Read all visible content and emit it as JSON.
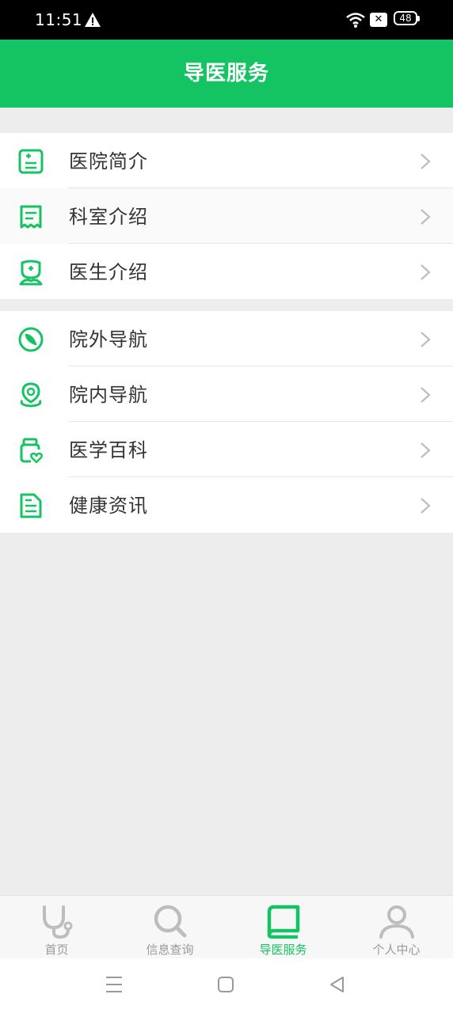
{
  "status": {
    "time": "11:51",
    "battery": "48",
    "x_badge": "✕"
  },
  "header": {
    "title": "导医服务"
  },
  "groups": [
    {
      "items": [
        {
          "label": "医院简介",
          "icon": "clipboard-plus-icon"
        },
        {
          "label": "科室介绍",
          "icon": "receipt-icon"
        },
        {
          "label": "医生介绍",
          "icon": "doctor-icon"
        }
      ]
    },
    {
      "items": [
        {
          "label": "院外导航",
          "icon": "compass-icon"
        },
        {
          "label": "院内导航",
          "icon": "location-pin-icon"
        },
        {
          "label": "医学百科",
          "icon": "medicine-bottle-icon"
        },
        {
          "label": "健康资讯",
          "icon": "document-icon"
        }
      ]
    }
  ],
  "tabbar": {
    "active": 2,
    "tabs": [
      {
        "label": "首页",
        "icon": "stethoscope-icon"
      },
      {
        "label": "信息查询",
        "icon": "search-icon"
      },
      {
        "label": "导医服务",
        "icon": "book-icon"
      },
      {
        "label": "个人中心",
        "icon": "user-icon"
      }
    ]
  },
  "colors": {
    "brand": "#14c462",
    "inactive": "#9a9a9a",
    "background": "#ededed"
  }
}
